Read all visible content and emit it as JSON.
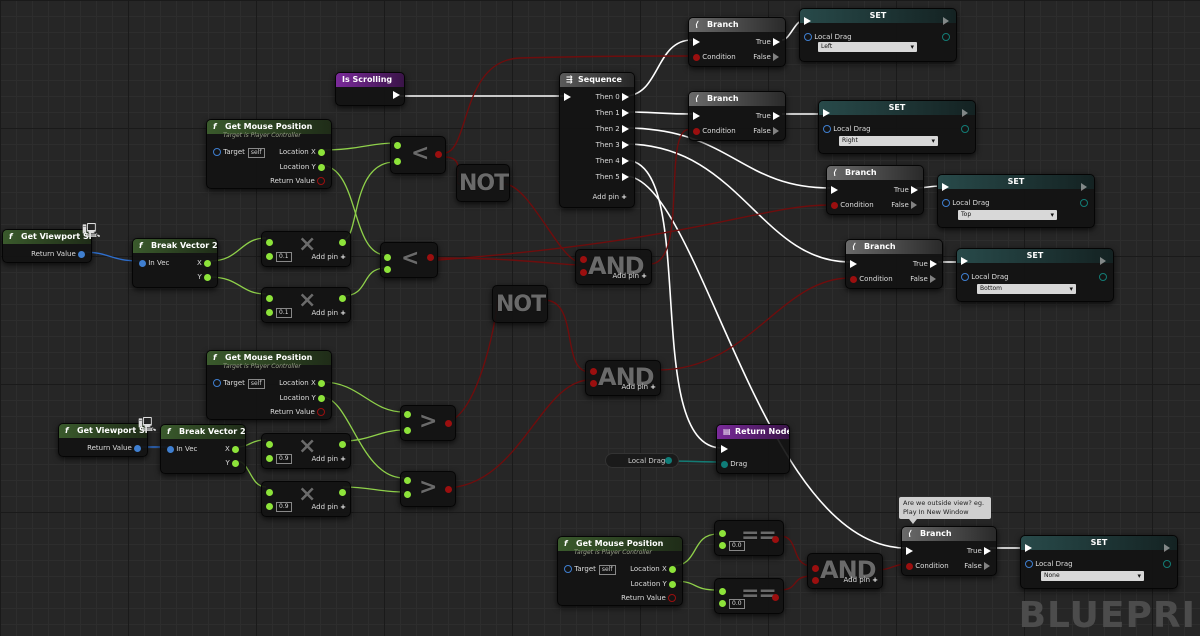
{
  "colors": {
    "exec_wire": "#ffffff",
    "bool_wire": "#6b0c0c",
    "float_wire": "#9cdb58",
    "vector_wire": "#2d6fd0",
    "struct_wire": "#137c75"
  },
  "is_scrolling": {
    "title": "Is Scrolling"
  },
  "sequence": {
    "title": "Sequence",
    "pins": [
      "Then 0",
      "Then 1",
      "Then 2",
      "Then 3",
      "Then 4",
      "Then 5"
    ],
    "add_pin": "Add pin"
  },
  "get_mouse_position": {
    "title": "Get Mouse Position",
    "subtitle": "Target is Player Controller",
    "target": "Target",
    "self": "self",
    "loc_x": "Location X",
    "loc_y": "Location Y",
    "ret": "Return Value"
  },
  "get_viewport_size": {
    "title": "Get Viewport Size",
    "ret": "Return Value"
  },
  "break_vector": {
    "title": "Break Vector 2D",
    "in": "In Vec",
    "x": "X",
    "y": "Y"
  },
  "multiply": {
    "add_pin": "Add pin",
    "v1": "0.1",
    "v9": "0.9"
  },
  "ops": {
    "less": "<",
    "greater": ">",
    "not": "NOT",
    "and": "AND",
    "eq": "==",
    "mul": "×"
  },
  "branch": {
    "title": "Branch",
    "cond": "Condition",
    "true": "True",
    "false": "False"
  },
  "set_node": {
    "title": "SET",
    "var": "Local Drag"
  },
  "drag_values": [
    "Left",
    "Right",
    "Top",
    "Bottom",
    "None"
  ],
  "equals": {
    "value": "0.0"
  },
  "return_node": {
    "title": "Return Node",
    "drag": "Drag"
  },
  "local_drag_var": "Local Drag",
  "comment": "Are we outside view? eg. Play In New Window",
  "watermark": "BLUEPRI"
}
